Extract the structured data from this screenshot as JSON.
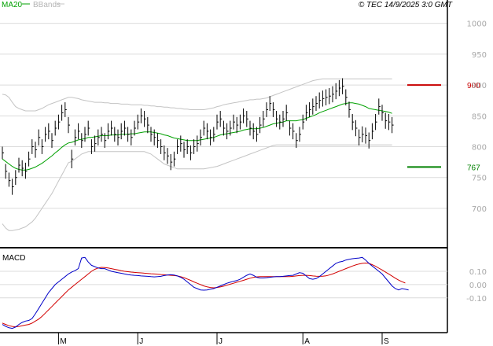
{
  "header": {
    "ma_label": "MA20",
    "bb_label": "BBands",
    "copyright": "© TEC 14/9/2025 3:0 GMT"
  },
  "colors": {
    "ma": "#00a000",
    "bands": "#c4c4c4",
    "price": "#000000",
    "macd": "#0000c8",
    "signal": "#d20000",
    "resistance": "#c80000",
    "support": "#008000",
    "grid": "#dcdcdc",
    "axis_text": "#a8a8a8"
  },
  "chart_data": [
    {
      "type": "ohlc",
      "title": "",
      "x_labels": [
        "M",
        "J",
        "J",
        "A",
        "S"
      ],
      "x_label_bar_index": [
        17,
        41,
        65,
        91,
        115
      ],
      "y_ticks": [
        700,
        750,
        800,
        850,
        900,
        950,
        1000
      ],
      "ylim": [
        640,
        1020
      ],
      "grid": true,
      "close": [
        790,
        760,
        745,
        735,
        750,
        770,
        765,
        760,
        780,
        800,
        795,
        815,
        800,
        820,
        825,
        810,
        830,
        840,
        855,
        860,
        835,
        780,
        815,
        825,
        810,
        820,
        830,
        800,
        805,
        815,
        820,
        810,
        825,
        830,
        820,
        815,
        825,
        830,
        820,
        815,
        830,
        840,
        850,
        845,
        835,
        820,
        815,
        810,
        800,
        790,
        785,
        775,
        780,
        800,
        805,
        795,
        800,
        790,
        800,
        805,
        815,
        830,
        825,
        815,
        820,
        840,
        845,
        830,
        825,
        830,
        840,
        835,
        840,
        850,
        845,
        830,
        825,
        820,
        835,
        845,
        860,
        870,
        860,
        845,
        840,
        845,
        855,
        830,
        825,
        810,
        820,
        840,
        855,
        860,
        865,
        870,
        875,
        878,
        880,
        882,
        885,
        890,
        895,
        898,
        880,
        860,
        840,
        830,
        815,
        820,
        818,
        810,
        825,
        840,
        865,
        855,
        842,
        840,
        835
      ],
      "range": [
        [
          780,
          800
        ],
        [
          748,
          772
        ],
        [
          735,
          758
        ],
        [
          722,
          748
        ],
        [
          738,
          762
        ],
        [
          758,
          782
        ],
        [
          752,
          778
        ],
        [
          748,
          774
        ],
        [
          768,
          792
        ],
        [
          788,
          812
        ],
        [
          782,
          808
        ],
        [
          802,
          828
        ],
        [
          788,
          812
        ],
        [
          808,
          832
        ],
        [
          812,
          838
        ],
        [
          798,
          822
        ],
        [
          818,
          842
        ],
        [
          828,
          852
        ],
        [
          842,
          868
        ],
        [
          848,
          872
        ],
        [
          822,
          848
        ],
        [
          765,
          795
        ],
        [
          802,
          828
        ],
        [
          812,
          838
        ],
        [
          798,
          822
        ],
        [
          808,
          832
        ],
        [
          818,
          842
        ],
        [
          788,
          812
        ],
        [
          792,
          818
        ],
        [
          802,
          828
        ],
        [
          808,
          832
        ],
        [
          798,
          822
        ],
        [
          812,
          838
        ],
        [
          818,
          842
        ],
        [
          808,
          832
        ],
        [
          802,
          828
        ],
        [
          812,
          838
        ],
        [
          818,
          842
        ],
        [
          808,
          832
        ],
        [
          802,
          828
        ],
        [
          818,
          842
        ],
        [
          828,
          852
        ],
        [
          838,
          862
        ],
        [
          832,
          858
        ],
        [
          822,
          848
        ],
        [
          808,
          832
        ],
        [
          802,
          828
        ],
        [
          798,
          822
        ],
        [
          788,
          812
        ],
        [
          778,
          802
        ],
        [
          772,
          798
        ],
        [
          762,
          788
        ],
        [
          768,
          792
        ],
        [
          788,
          812
        ],
        [
          792,
          818
        ],
        [
          782,
          808
        ],
        [
          788,
          812
        ],
        [
          778,
          802
        ],
        [
          788,
          812
        ],
        [
          792,
          818
        ],
        [
          802,
          828
        ],
        [
          818,
          842
        ],
        [
          812,
          838
        ],
        [
          802,
          828
        ],
        [
          808,
          832
        ],
        [
          828,
          852
        ],
        [
          832,
          858
        ],
        [
          818,
          842
        ],
        [
          812,
          838
        ],
        [
          818,
          842
        ],
        [
          828,
          852
        ],
        [
          822,
          848
        ],
        [
          828,
          852
        ],
        [
          838,
          862
        ],
        [
          832,
          858
        ],
        [
          818,
          842
        ],
        [
          812,
          838
        ],
        [
          808,
          832
        ],
        [
          822,
          848
        ],
        [
          832,
          858
        ],
        [
          848,
          872
        ],
        [
          858,
          882
        ],
        [
          848,
          872
        ],
        [
          832,
          858
        ],
        [
          828,
          852
        ],
        [
          832,
          858
        ],
        [
          842,
          868
        ],
        [
          818,
          842
        ],
        [
          812,
          838
        ],
        [
          798,
          822
        ],
        [
          808,
          832
        ],
        [
          828,
          852
        ],
        [
          842,
          868
        ],
        [
          848,
          872
        ],
        [
          852,
          878
        ],
        [
          858,
          882
        ],
        [
          862,
          888
        ],
        [
          865,
          891
        ],
        [
          867,
          893
        ],
        [
          869,
          895
        ],
        [
          872,
          898
        ],
        [
          877,
          903
        ],
        [
          882,
          908
        ],
        [
          885,
          911
        ],
        [
          867,
          893
        ],
        [
          847,
          873
        ],
        [
          827,
          853
        ],
        [
          817,
          843
        ],
        [
          802,
          828
        ],
        [
          807,
          833
        ],
        [
          805,
          831
        ],
        [
          797,
          823
        ],
        [
          812,
          838
        ],
        [
          827,
          853
        ],
        [
          852,
          878
        ],
        [
          842,
          868
        ],
        [
          829,
          855
        ],
        [
          827,
          853
        ],
        [
          822,
          848
        ]
      ],
      "ma20": [
        780,
        776,
        772,
        768,
        765,
        763,
        762,
        762,
        763,
        765,
        767,
        770,
        773,
        777,
        781,
        785,
        790,
        794,
        799,
        803,
        806,
        807,
        809,
        811,
        812,
        813,
        815,
        815,
        816,
        817,
        818,
        818,
        818,
        819,
        819,
        819,
        820,
        820,
        820,
        821,
        821,
        822,
        823,
        824,
        824,
        824,
        823,
        822,
        821,
        819,
        818,
        816,
        814,
        813,
        812,
        811,
        810,
        810,
        810,
        810,
        811,
        812,
        813,
        814,
        815,
        817,
        819,
        820,
        821,
        822,
        823,
        824,
        825,
        827,
        828,
        829,
        829,
        829,
        830,
        831,
        833,
        835,
        837,
        838,
        839,
        840,
        842,
        842,
        842,
        842,
        843,
        844,
        846,
        848,
        850,
        852,
        855,
        857,
        859,
        861,
        863,
        865,
        867,
        869,
        870,
        871,
        871,
        870,
        869,
        867,
        865,
        862,
        861,
        860,
        859,
        858,
        857,
        856,
        854
      ],
      "bb_upper": [
        885,
        884,
        880,
        872,
        865,
        862,
        860,
        858,
        858,
        858,
        858,
        860,
        862,
        865,
        868,
        870,
        872,
        874,
        876,
        878,
        880,
        880,
        879,
        878,
        876,
        875,
        874,
        873,
        872,
        872,
        872,
        871,
        871,
        870,
        870,
        870,
        869,
        869,
        869,
        868,
        868,
        868,
        868,
        867,
        867,
        866,
        866,
        865,
        865,
        864,
        864,
        863,
        863,
        862,
        862,
        861,
        861,
        860,
        860,
        860,
        860,
        860,
        861,
        862,
        863,
        865,
        866,
        868,
        869,
        870,
        871,
        872,
        873,
        874,
        875,
        876,
        876,
        877,
        877,
        878,
        879,
        881,
        883,
        885,
        887,
        889,
        891,
        893,
        895,
        897,
        899,
        901,
        903,
        905,
        907,
        908,
        909,
        910,
        910,
        910,
        910,
        910,
        910,
        910,
        910,
        910,
        910,
        910,
        910,
        910,
        910,
        910,
        910,
        910,
        910,
        910,
        910,
        910,
        910
      ],
      "bb_lower": [
        675,
        668,
        664,
        664,
        665,
        666,
        668,
        670,
        674,
        678,
        684,
        692,
        700,
        708,
        716,
        724,
        734,
        744,
        754,
        764,
        774,
        776,
        780,
        784,
        788,
        790,
        792,
        792,
        792,
        792,
        792,
        792,
        792,
        792,
        792,
        792,
        792,
        792,
        792,
        792,
        792,
        792,
        792,
        792,
        790,
        788,
        784,
        780,
        776,
        772,
        770,
        768,
        766,
        764,
        764,
        764,
        764,
        764,
        764,
        764,
        764,
        764,
        765,
        766,
        767,
        768,
        770,
        772,
        774,
        776,
        778,
        780,
        782,
        784,
        786,
        788,
        790,
        792,
        794,
        796,
        798,
        800,
        802,
        803,
        803,
        803,
        803,
        803,
        803,
        803,
        803,
        803,
        803,
        803,
        803,
        803,
        803,
        803,
        803,
        803,
        803,
        803,
        803,
        803,
        803,
        803,
        803,
        803,
        803,
        803,
        803,
        803,
        803,
        803,
        803,
        803,
        803,
        803,
        803
      ],
      "levels": [
        {
          "name": "resistance",
          "value": 900,
          "label": "900"
        },
        {
          "name": "support",
          "value": 767,
          "label": "767"
        }
      ]
    },
    {
      "type": "line",
      "title": "MACD",
      "y_ticks": [
        0.1,
        0,
        -0.1
      ],
      "y_tick_labels": [
        "0.10",
        "0.00",
        "-0.10"
      ],
      "ylim": [
        -0.35,
        0.26
      ],
      "macd": [
        -0.3,
        -0.315,
        -0.325,
        -0.33,
        -0.32,
        -0.3,
        -0.285,
        -0.275,
        -0.27,
        -0.255,
        -0.22,
        -0.18,
        -0.14,
        -0.1,
        -0.06,
        -0.03,
        0.0,
        0.02,
        0.04,
        0.06,
        0.08,
        0.095,
        0.105,
        0.12,
        0.2,
        0.205,
        0.17,
        0.145,
        0.135,
        0.125,
        0.12,
        0.12,
        0.11,
        0.1,
        0.095,
        0.09,
        0.085,
        0.08,
        0.075,
        0.072,
        0.07,
        0.068,
        0.065,
        0.064,
        0.062,
        0.06,
        0.058,
        0.06,
        0.062,
        0.068,
        0.072,
        0.075,
        0.072,
        0.065,
        0.055,
        0.04,
        0.02,
        0.0,
        -0.02,
        -0.03,
        -0.04,
        -0.042,
        -0.04,
        -0.035,
        -0.03,
        -0.02,
        -0.01,
        0.0,
        0.01,
        0.018,
        0.025,
        0.03,
        0.04,
        0.055,
        0.07,
        0.08,
        0.07,
        0.055,
        0.05,
        0.05,
        0.052,
        0.055,
        0.058,
        0.06,
        0.06,
        0.062,
        0.065,
        0.068,
        0.07,
        0.08,
        0.09,
        0.085,
        0.065,
        0.045,
        0.04,
        0.045,
        0.06,
        0.08,
        0.1,
        0.12,
        0.14,
        0.16,
        0.17,
        0.175,
        0.185,
        0.19,
        0.195,
        0.198,
        0.2,
        0.205,
        0.185,
        0.16,
        0.14,
        0.12,
        0.1,
        0.08,
        0.05,
        0.02,
        -0.01,
        -0.03,
        -0.04,
        -0.03,
        -0.035,
        -0.04
      ],
      "signal": [
        -0.29,
        -0.3,
        -0.31,
        -0.315,
        -0.318,
        -0.315,
        -0.31,
        -0.305,
        -0.3,
        -0.29,
        -0.275,
        -0.26,
        -0.24,
        -0.215,
        -0.19,
        -0.165,
        -0.14,
        -0.115,
        -0.09,
        -0.065,
        -0.04,
        -0.02,
        0.0,
        0.02,
        0.04,
        0.06,
        0.08,
        0.1,
        0.115,
        0.125,
        0.13,
        0.128,
        0.125,
        0.12,
        0.115,
        0.11,
        0.105,
        0.1,
        0.097,
        0.094,
        0.092,
        0.09,
        0.088,
        0.086,
        0.084,
        0.082,
        0.08,
        0.078,
        0.076,
        0.074,
        0.072,
        0.07,
        0.068,
        0.065,
        0.06,
        0.052,
        0.042,
        0.032,
        0.02,
        0.01,
        0.0,
        -0.01,
        -0.017,
        -0.022,
        -0.024,
        -0.022,
        -0.018,
        -0.012,
        -0.005,
        0.003,
        0.01,
        0.018,
        0.025,
        0.032,
        0.04,
        0.048,
        0.054,
        0.058,
        0.06,
        0.06,
        0.06,
        0.06,
        0.06,
        0.06,
        0.06,
        0.06,
        0.06,
        0.06,
        0.062,
        0.065,
        0.068,
        0.07,
        0.07,
        0.068,
        0.065,
        0.063,
        0.062,
        0.063,
        0.066,
        0.072,
        0.08,
        0.09,
        0.1,
        0.11,
        0.12,
        0.13,
        0.14,
        0.148,
        0.155,
        0.16,
        0.162,
        0.16,
        0.15,
        0.138,
        0.124,
        0.11,
        0.095,
        0.08,
        0.064,
        0.048,
        0.034,
        0.022,
        0.012
      ]
    }
  ]
}
